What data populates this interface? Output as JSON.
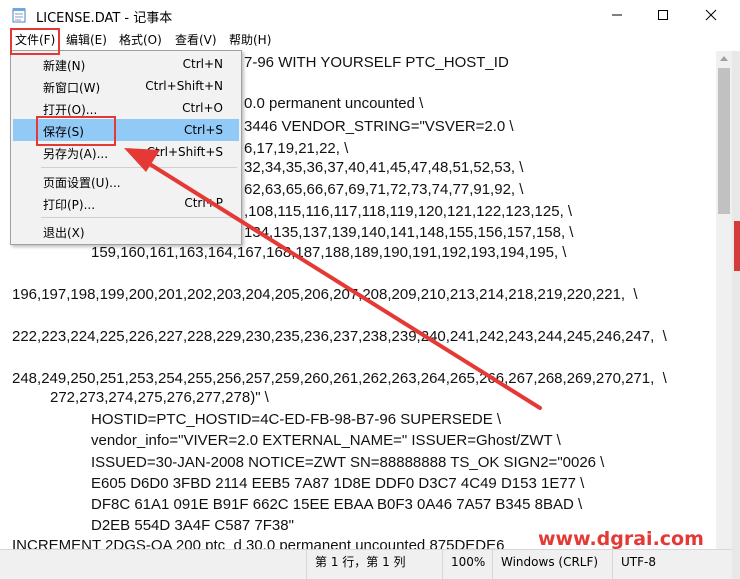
{
  "window": {
    "title": "LICENSE.DAT - 记事本"
  },
  "menu": {
    "file": "文件(F)",
    "edit": "编辑(E)",
    "format": "格式(O)",
    "view": "查看(V)",
    "help": "帮助(H)"
  },
  "file_menu": {
    "items": [
      {
        "label": "新建(N)",
        "shortcut": "Ctrl+N"
      },
      {
        "label": "新窗口(W)",
        "shortcut": "Ctrl+Shift+N"
      },
      {
        "label": "打开(O)...",
        "shortcut": "Ctrl+O"
      },
      {
        "label": "保存(S)",
        "shortcut": "Ctrl+S",
        "highlighted": true
      },
      {
        "label": "另存为(A)...",
        "shortcut": "Ctrl+Shift+S"
      },
      {
        "label": "页面设置(U)...",
        "shortcut": ""
      },
      {
        "label": "打印(P)...",
        "shortcut": "Ctrl+P"
      },
      {
        "label": "退出(X)",
        "shortcut": ""
      }
    ]
  },
  "editor": {
    "lines": [
      "7-96 WITH YOURSELF PTC_HOST_ID",
      "",
      "0.0 permanent uncounted \\",
      "3446 VENDOR_STRING=\"VSVER=2.0 \\",
      "6,17,19,21,22, \\",
      "32,34,35,36,37,40,41,45,47,48,51,52,53, \\",
      "62,63,65,66,67,69,71,72,73,74,77,91,92, \\",
      ",108,115,116,117,118,119,120,121,122,123,125, \\",
      "134,135,137,139,140,141,148,155,156,157,158, \\",
      "159,160,161,163,164,167,168,187,188,189,190,191,192,193,194,195, \\",
      "",
      "196,197,198,199,200,201,202,203,204,205,206,207,208,209,210,213,214,218,219,220,221,  \\",
      "",
      "222,223,224,225,226,227,228,229,230,235,236,237,238,239,240,241,242,243,244,245,246,247,  \\",
      "",
      "248,249,250,251,253,254,255,256,257,259,260,261,262,263,264,265,266,267,268,269,270,271,  \\",
      "272,273,274,275,276,277,278)\" \\",
      "HOSTID=PTC_HOSTID=4C-ED-FB-98-B7-96 SUPERSEDE \\",
      "vendor_info=\"VIVER=2.0 EXTERNAL_NAME=\" ISSUER=Ghost/ZWT \\",
      "ISSUED=30-JAN-2008 NOTICE=ZWT SN=88888888 TS_OK SIGN2=\"0026 \\",
      "E605 D6D0 3FBD 2114 EEB5 7A87 1D8E DDF0 D3C7 4C49 D153 1E77 \\",
      "DF8C 61A1 091E B91F 662C 15EE EBAA B0F3 0A46 7A57 B345 8BAD \\",
      "D2EB 554D 3A4F C587 7F38\"",
      "INCREMENT 2DGS-OA 200 ptc_d 30.0 permanent uncounted 875DEDE6"
    ]
  },
  "status": {
    "position": "第 1 行，第 1 列",
    "zoom": "100%",
    "line_ending": "Windows (CRLF)",
    "encoding": "UTF-8"
  },
  "watermark": "www.dgrai.com",
  "colors": {
    "highlight": "#91c9f7",
    "annotation": "#e53935"
  }
}
